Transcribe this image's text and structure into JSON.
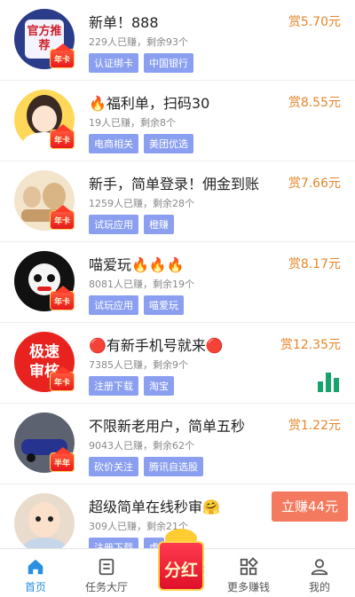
{
  "tasks": [
    {
      "title": "新单！888",
      "meta": "229人已赚，剩余93个",
      "tags": [
        "认证绑卡",
        "中国银行"
      ],
      "reward": "赏5.70元",
      "badge": "年卡",
      "avatar_text": "官方推荐"
    },
    {
      "title": "🔥福利单，扫码30",
      "meta": "19人已赚，剩余8个",
      "tags": [
        "电商相关",
        "美团优选"
      ],
      "reward": "赏8.55元",
      "badge": "年卡"
    },
    {
      "title": "新手，简单登录！佣金到账",
      "meta": "1259人已赚，剩余28个",
      "tags": [
        "试玩应用",
        "橙赚"
      ],
      "reward": "赏7.66元",
      "badge": "年卡"
    },
    {
      "title": "喵爱玩🔥🔥🔥",
      "meta": "8081人已赚，剩余19个",
      "tags": [
        "试玩应用",
        "喵爱玩"
      ],
      "reward": "赏8.17元",
      "badge": "年卡"
    },
    {
      "title": "🔴有新手机号就来🔴",
      "meta": "7385人已赚，剩余9个",
      "tags": [
        "注册下载",
        "淘宝"
      ],
      "reward": "赏12.35元",
      "badge": "年卡",
      "avatar_text": "极速审核"
    },
    {
      "title": "不限新老用户，简单五秒",
      "meta": "9043人已赚，剩余62个",
      "tags": [
        "砍价关注",
        "腾讯自选股"
      ],
      "reward": "赏1.22元",
      "badge": "半年"
    },
    {
      "title": "超级简单在线秒审🤗",
      "meta": "309人已赚，剩余21个",
      "tags": [
        "注册下载",
        "虎"
      ],
      "earn_button": "立赚44元"
    }
  ],
  "tabbar": [
    {
      "label": "首页",
      "icon": "home-icon",
      "active": true
    },
    {
      "label": "任务大厅",
      "icon": "task-list-icon",
      "active": false
    },
    {
      "label": "",
      "icon": "red-envelope-icon",
      "active": false
    },
    {
      "label": "更多赚钱",
      "icon": "apps-grid-icon",
      "active": false
    },
    {
      "label": "我的",
      "icon": "user-icon",
      "active": false
    }
  ],
  "fenhong_label": "分红",
  "colors": {
    "accent": "#2a8fe0",
    "reward": "#e6862a",
    "tag": "#8b9ff0",
    "earn_button": "#f47a5f",
    "chart_icon": "#17a36b"
  }
}
